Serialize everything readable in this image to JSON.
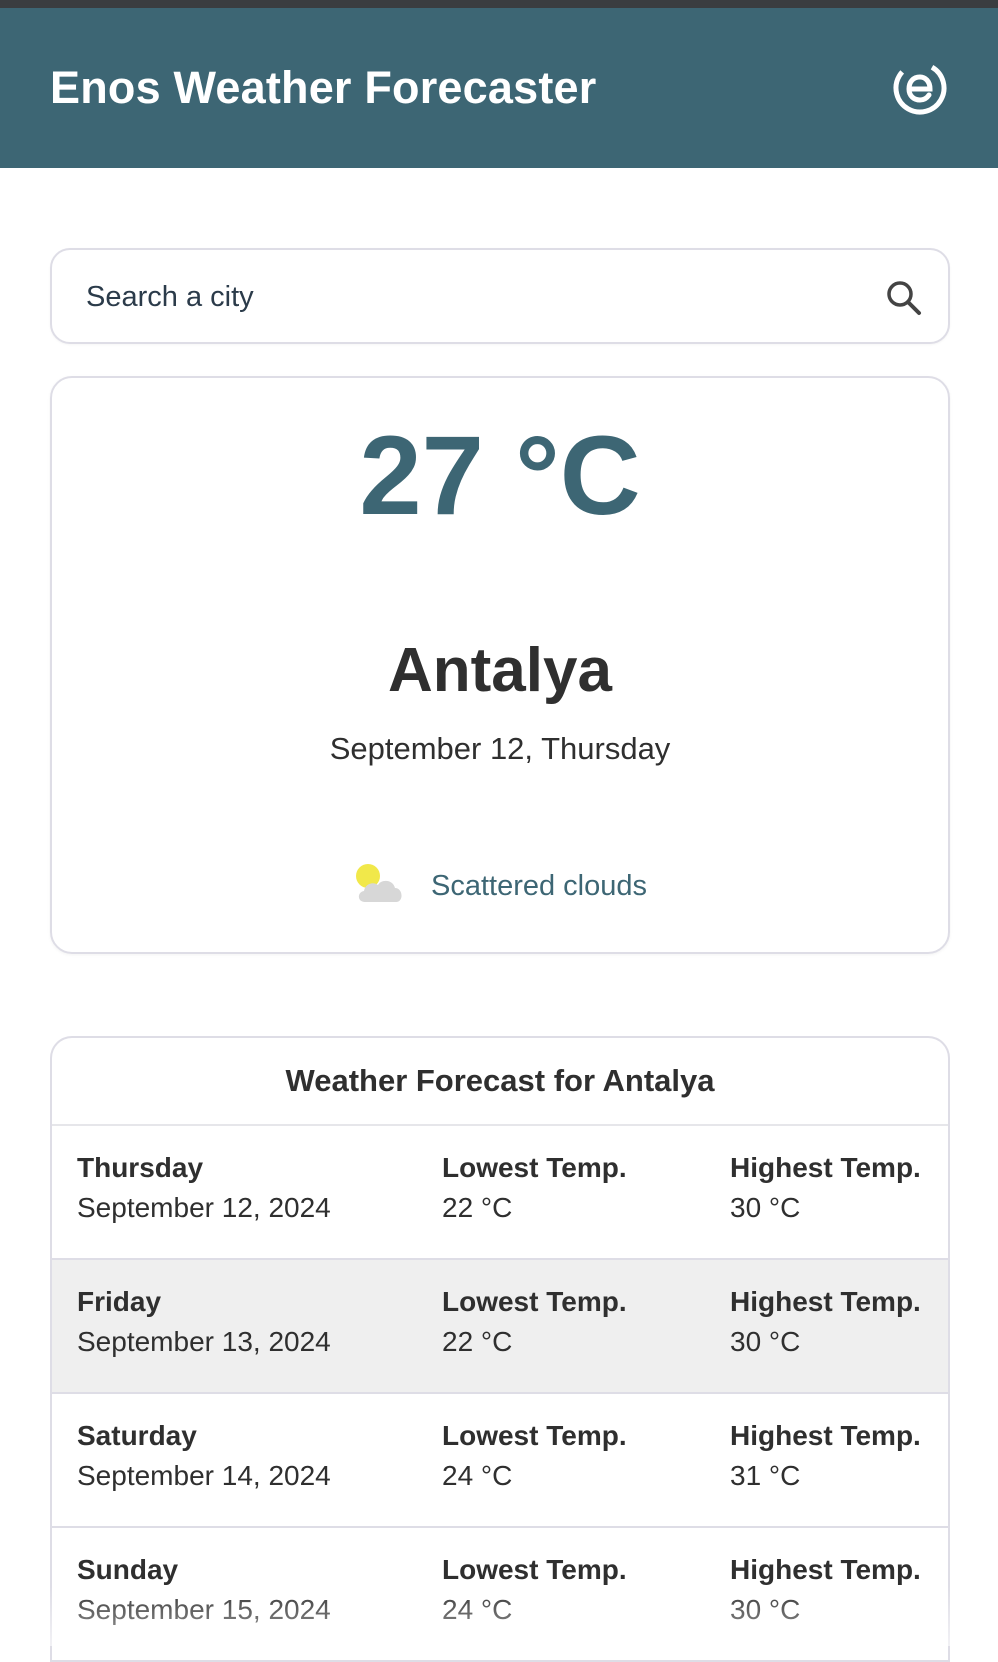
{
  "header": {
    "title": "Enos Weather Forecaster",
    "logo_icon": "enos-logo-icon"
  },
  "search": {
    "placeholder": "Search a city",
    "icon": "search-icon"
  },
  "current": {
    "temperature": "27 °C",
    "city": "Antalya",
    "date": "September 12, Thursday",
    "condition": "Scattered clouds",
    "condition_icon": "partly-cloudy-icon"
  },
  "forecast": {
    "title": "Weather Forecast for Antalya",
    "days": [
      {
        "day": "Thursday",
        "date": "September 12, 2024",
        "low_label": "Lowest Temp.",
        "low": "22 °C",
        "high_label": "Highest Temp.",
        "high": "30 °C"
      },
      {
        "day": "Friday",
        "date": "September 13, 2024",
        "low_label": "Lowest Temp.",
        "low": "22 °C",
        "high_label": "Highest Temp.",
        "high": "30 °C"
      },
      {
        "day": "Saturday",
        "date": "September 14, 2024",
        "low_label": "Lowest Temp.",
        "low": "24 °C",
        "high_label": "Highest Temp.",
        "high": "31 °C"
      },
      {
        "day": "Sunday",
        "date": "September 15, 2024",
        "low_label": "Lowest Temp.",
        "low": "24 °C",
        "high_label": "Highest Temp.",
        "high": "30 °C"
      }
    ]
  },
  "colors": {
    "brand": "#3d6674",
    "text": "#2f2f2f",
    "border": "#dedde6",
    "alt_row": "#efefef"
  }
}
